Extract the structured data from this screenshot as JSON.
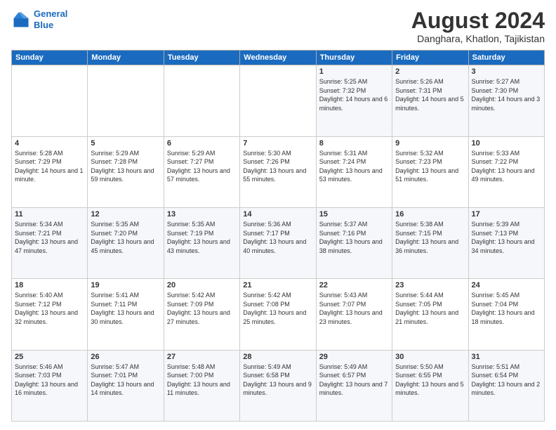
{
  "header": {
    "logo_line1": "General",
    "logo_line2": "Blue",
    "month_year": "August 2024",
    "location": "Danghara, Khatlon, Tajikistan"
  },
  "weekdays": [
    "Sunday",
    "Monday",
    "Tuesday",
    "Wednesday",
    "Thursday",
    "Friday",
    "Saturday"
  ],
  "weeks": [
    [
      {
        "day": "",
        "sunrise": "",
        "sunset": "",
        "daylight": ""
      },
      {
        "day": "",
        "sunrise": "",
        "sunset": "",
        "daylight": ""
      },
      {
        "day": "",
        "sunrise": "",
        "sunset": "",
        "daylight": ""
      },
      {
        "day": "",
        "sunrise": "",
        "sunset": "",
        "daylight": ""
      },
      {
        "day": "1",
        "sunrise": "Sunrise: 5:25 AM",
        "sunset": "Sunset: 7:32 PM",
        "daylight": "Daylight: 14 hours and 6 minutes."
      },
      {
        "day": "2",
        "sunrise": "Sunrise: 5:26 AM",
        "sunset": "Sunset: 7:31 PM",
        "daylight": "Daylight: 14 hours and 5 minutes."
      },
      {
        "day": "3",
        "sunrise": "Sunrise: 5:27 AM",
        "sunset": "Sunset: 7:30 PM",
        "daylight": "Daylight: 14 hours and 3 minutes."
      }
    ],
    [
      {
        "day": "4",
        "sunrise": "Sunrise: 5:28 AM",
        "sunset": "Sunset: 7:29 PM",
        "daylight": "Daylight: 14 hours and 1 minute."
      },
      {
        "day": "5",
        "sunrise": "Sunrise: 5:29 AM",
        "sunset": "Sunset: 7:28 PM",
        "daylight": "Daylight: 13 hours and 59 minutes."
      },
      {
        "day": "6",
        "sunrise": "Sunrise: 5:29 AM",
        "sunset": "Sunset: 7:27 PM",
        "daylight": "Daylight: 13 hours and 57 minutes."
      },
      {
        "day": "7",
        "sunrise": "Sunrise: 5:30 AM",
        "sunset": "Sunset: 7:26 PM",
        "daylight": "Daylight: 13 hours and 55 minutes."
      },
      {
        "day": "8",
        "sunrise": "Sunrise: 5:31 AM",
        "sunset": "Sunset: 7:24 PM",
        "daylight": "Daylight: 13 hours and 53 minutes."
      },
      {
        "day": "9",
        "sunrise": "Sunrise: 5:32 AM",
        "sunset": "Sunset: 7:23 PM",
        "daylight": "Daylight: 13 hours and 51 minutes."
      },
      {
        "day": "10",
        "sunrise": "Sunrise: 5:33 AM",
        "sunset": "Sunset: 7:22 PM",
        "daylight": "Daylight: 13 hours and 49 minutes."
      }
    ],
    [
      {
        "day": "11",
        "sunrise": "Sunrise: 5:34 AM",
        "sunset": "Sunset: 7:21 PM",
        "daylight": "Daylight: 13 hours and 47 minutes."
      },
      {
        "day": "12",
        "sunrise": "Sunrise: 5:35 AM",
        "sunset": "Sunset: 7:20 PM",
        "daylight": "Daylight: 13 hours and 45 minutes."
      },
      {
        "day": "13",
        "sunrise": "Sunrise: 5:35 AM",
        "sunset": "Sunset: 7:19 PM",
        "daylight": "Daylight: 13 hours and 43 minutes."
      },
      {
        "day": "14",
        "sunrise": "Sunrise: 5:36 AM",
        "sunset": "Sunset: 7:17 PM",
        "daylight": "Daylight: 13 hours and 40 minutes."
      },
      {
        "day": "15",
        "sunrise": "Sunrise: 5:37 AM",
        "sunset": "Sunset: 7:16 PM",
        "daylight": "Daylight: 13 hours and 38 minutes."
      },
      {
        "day": "16",
        "sunrise": "Sunrise: 5:38 AM",
        "sunset": "Sunset: 7:15 PM",
        "daylight": "Daylight: 13 hours and 36 minutes."
      },
      {
        "day": "17",
        "sunrise": "Sunrise: 5:39 AM",
        "sunset": "Sunset: 7:13 PM",
        "daylight": "Daylight: 13 hours and 34 minutes."
      }
    ],
    [
      {
        "day": "18",
        "sunrise": "Sunrise: 5:40 AM",
        "sunset": "Sunset: 7:12 PM",
        "daylight": "Daylight: 13 hours and 32 minutes."
      },
      {
        "day": "19",
        "sunrise": "Sunrise: 5:41 AM",
        "sunset": "Sunset: 7:11 PM",
        "daylight": "Daylight: 13 hours and 30 minutes."
      },
      {
        "day": "20",
        "sunrise": "Sunrise: 5:42 AM",
        "sunset": "Sunset: 7:09 PM",
        "daylight": "Daylight: 13 hours and 27 minutes."
      },
      {
        "day": "21",
        "sunrise": "Sunrise: 5:42 AM",
        "sunset": "Sunset: 7:08 PM",
        "daylight": "Daylight: 13 hours and 25 minutes."
      },
      {
        "day": "22",
        "sunrise": "Sunrise: 5:43 AM",
        "sunset": "Sunset: 7:07 PM",
        "daylight": "Daylight: 13 hours and 23 minutes."
      },
      {
        "day": "23",
        "sunrise": "Sunrise: 5:44 AM",
        "sunset": "Sunset: 7:05 PM",
        "daylight": "Daylight: 13 hours and 21 minutes."
      },
      {
        "day": "24",
        "sunrise": "Sunrise: 5:45 AM",
        "sunset": "Sunset: 7:04 PM",
        "daylight": "Daylight: 13 hours and 18 minutes."
      }
    ],
    [
      {
        "day": "25",
        "sunrise": "Sunrise: 5:46 AM",
        "sunset": "Sunset: 7:03 PM",
        "daylight": "Daylight: 13 hours and 16 minutes."
      },
      {
        "day": "26",
        "sunrise": "Sunrise: 5:47 AM",
        "sunset": "Sunset: 7:01 PM",
        "daylight": "Daylight: 13 hours and 14 minutes."
      },
      {
        "day": "27",
        "sunrise": "Sunrise: 5:48 AM",
        "sunset": "Sunset: 7:00 PM",
        "daylight": "Daylight: 13 hours and 11 minutes."
      },
      {
        "day": "28",
        "sunrise": "Sunrise: 5:49 AM",
        "sunset": "Sunset: 6:58 PM",
        "daylight": "Daylight: 13 hours and 9 minutes."
      },
      {
        "day": "29",
        "sunrise": "Sunrise: 5:49 AM",
        "sunset": "Sunset: 6:57 PM",
        "daylight": "Daylight: 13 hours and 7 minutes."
      },
      {
        "day": "30",
        "sunrise": "Sunrise: 5:50 AM",
        "sunset": "Sunset: 6:55 PM",
        "daylight": "Daylight: 13 hours and 5 minutes."
      },
      {
        "day": "31",
        "sunrise": "Sunrise: 5:51 AM",
        "sunset": "Sunset: 6:54 PM",
        "daylight": "Daylight: 13 hours and 2 minutes."
      }
    ]
  ]
}
